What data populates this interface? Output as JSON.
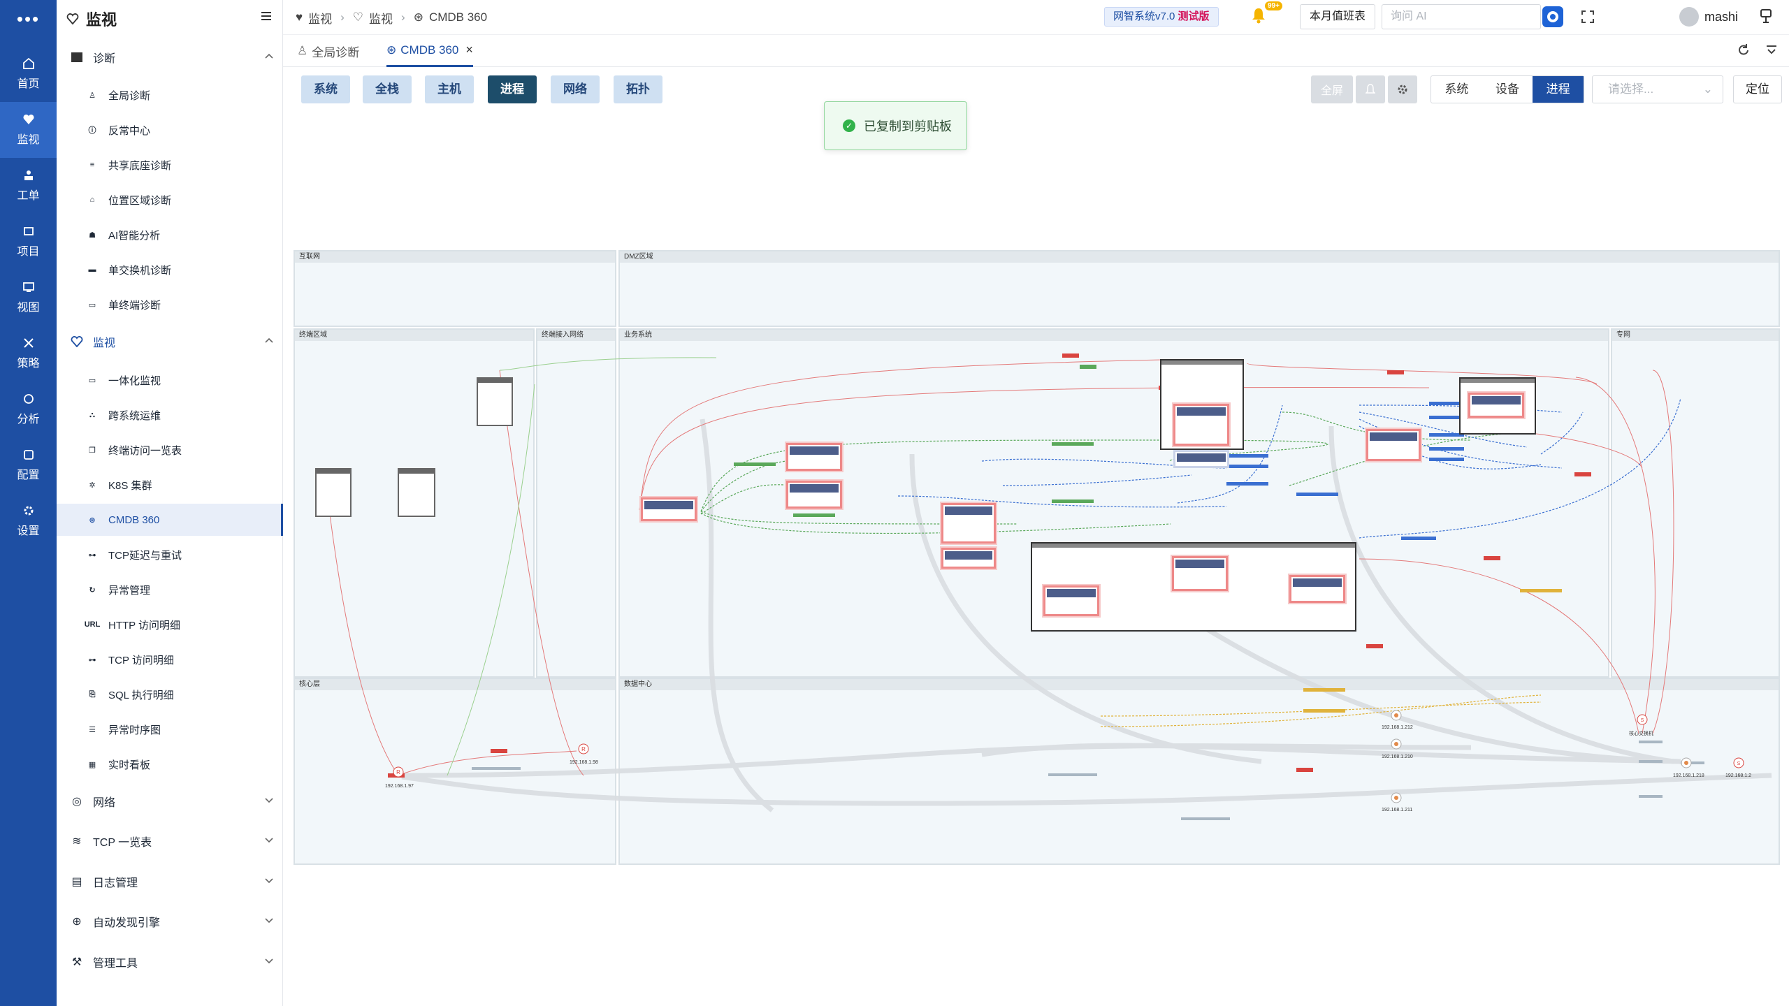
{
  "rail": {
    "items": [
      {
        "label": "首页",
        "icon": "home-icon"
      },
      {
        "label": "监视",
        "icon": "heartbeat-icon"
      },
      {
        "label": "工单",
        "icon": "ticket-icon"
      },
      {
        "label": "项目",
        "icon": "project-icon"
      },
      {
        "label": "视图",
        "icon": "view-icon"
      },
      {
        "label": "策略",
        "icon": "policy-icon"
      },
      {
        "label": "分析",
        "icon": "analysis-icon"
      },
      {
        "label": "配置",
        "icon": "config-icon"
      },
      {
        "label": "设置",
        "icon": "settings-icon"
      }
    ],
    "active_index": 1
  },
  "sidebar": {
    "title": "监视",
    "groups": [
      {
        "label": "诊断",
        "expanded": true,
        "items": [
          "全局诊断",
          "反常中心",
          "共享底座诊断",
          "位置区域诊断",
          "AI智能分析",
          "单交换机诊断",
          "单终端诊断"
        ]
      },
      {
        "label": "监视",
        "expanded": true,
        "items": [
          "一体化监视",
          "跨系统运维",
          "终端访问一览表",
          "K8S 集群",
          "CMDB 360",
          "TCP延迟与重试",
          "异常管理",
          "HTTP 访问明细",
          "TCP 访问明细",
          "SQL 执行明细",
          "异常时序图",
          "实时看板"
        ]
      },
      {
        "label": "网络",
        "expanded": false
      },
      {
        "label": "TCP 一览表",
        "expanded": false
      },
      {
        "label": "日志管理",
        "expanded": false
      },
      {
        "label": "自动发现引擎",
        "expanded": false
      },
      {
        "label": "管理工具",
        "expanded": false
      }
    ],
    "url_tag": "URL",
    "active_item": "CMDB 360"
  },
  "breadcrumb": [
    "监视",
    "监视",
    "CMDB 360"
  ],
  "topbar": {
    "version_prefix": "网智系统v7.0",
    "version_tag": "测试版",
    "badge": "99+",
    "duty": "本月值班表",
    "ask_placeholder": "询问 AI",
    "user": "mashi"
  },
  "tabs": [
    {
      "label": "全局诊断",
      "active": false
    },
    {
      "label": "CMDB 360",
      "active": true,
      "closable": true
    }
  ],
  "toolbar": {
    "views": [
      "系统",
      "全栈",
      "主机",
      "进程",
      "网络",
      "拓扑"
    ],
    "active_view": "进程",
    "fullscreen": "全屏",
    "segment": [
      "系统",
      "设备",
      "进程"
    ],
    "segment_active": "进程",
    "select_placeholder": "请选择...",
    "locate": "定位"
  },
  "toast": "已复制到剪贴板",
  "zones": {
    "internet": "互联网",
    "dmz": "DMZ区域",
    "terminal": "终端区域",
    "terminal_access": "终端接入网络",
    "business": "业务系统",
    "private": "专网",
    "core": "核心层",
    "datacenter": "数据中心"
  },
  "ips": [
    "192.168.1.97",
    "192.168.1.98",
    "192.168.1.212",
    "192.168.1.210",
    "192.168.1.211",
    "192.168.1.218",
    "192.168.1.2"
  ],
  "core_switch_label": "核心交换机",
  "colors": {
    "rail": "#1e4fa3",
    "accent": "#1e4fa3",
    "active_btn": "#1d4d6a",
    "toast_ok": "#31b24a",
    "alert": "#d4145a"
  }
}
